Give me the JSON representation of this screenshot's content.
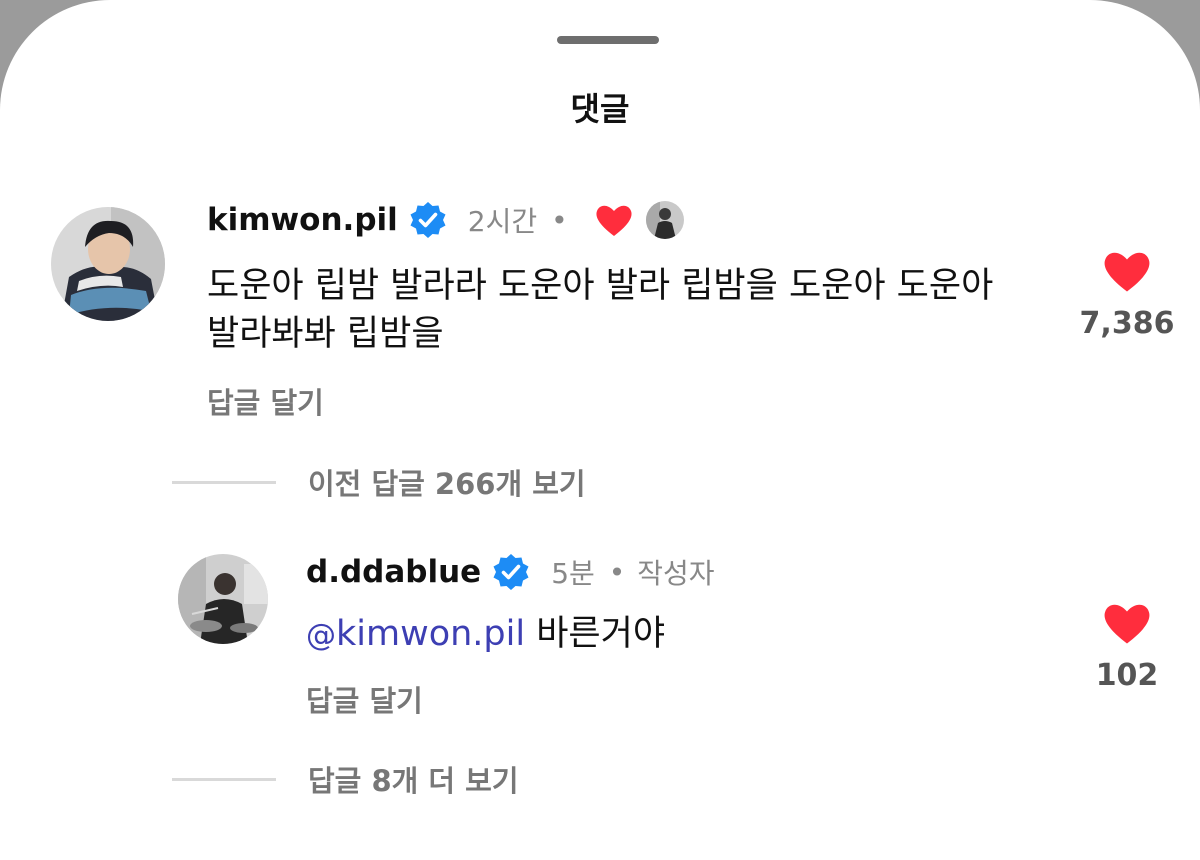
{
  "sheet": {
    "title": "댓글"
  },
  "comments": [
    {
      "username": "kimwon.pil",
      "time": "2시간",
      "separator": "•",
      "text_line1": "도운아 립밤 발라라 도운아 발라 립밤을 도운아 도운아",
      "text_line2": "발라봐봐 립밤을",
      "reply_label": "답글 달기",
      "like_count": "7,386"
    },
    {
      "username": "d.ddablue",
      "time": "5분",
      "separator": "•",
      "author_tag": "작성자",
      "mention_glyph": "@",
      "mention": "kimwon.pil",
      "text": " 바른거야",
      "reply_label": "답글 달기",
      "like_count": "102"
    }
  ],
  "threads": {
    "previous_replies_label": "이전 답글 266개 보기",
    "more_replies_label": "답글 8개 더 보기"
  },
  "colors": {
    "heart": "#ff2d3d",
    "verified": "#1d8cf5",
    "mention": "#3d3fb3",
    "muted_text": "#777777"
  },
  "icons": [
    "drag-handle",
    "verified-badge-icon",
    "heart-icon",
    "mention-icon"
  ]
}
